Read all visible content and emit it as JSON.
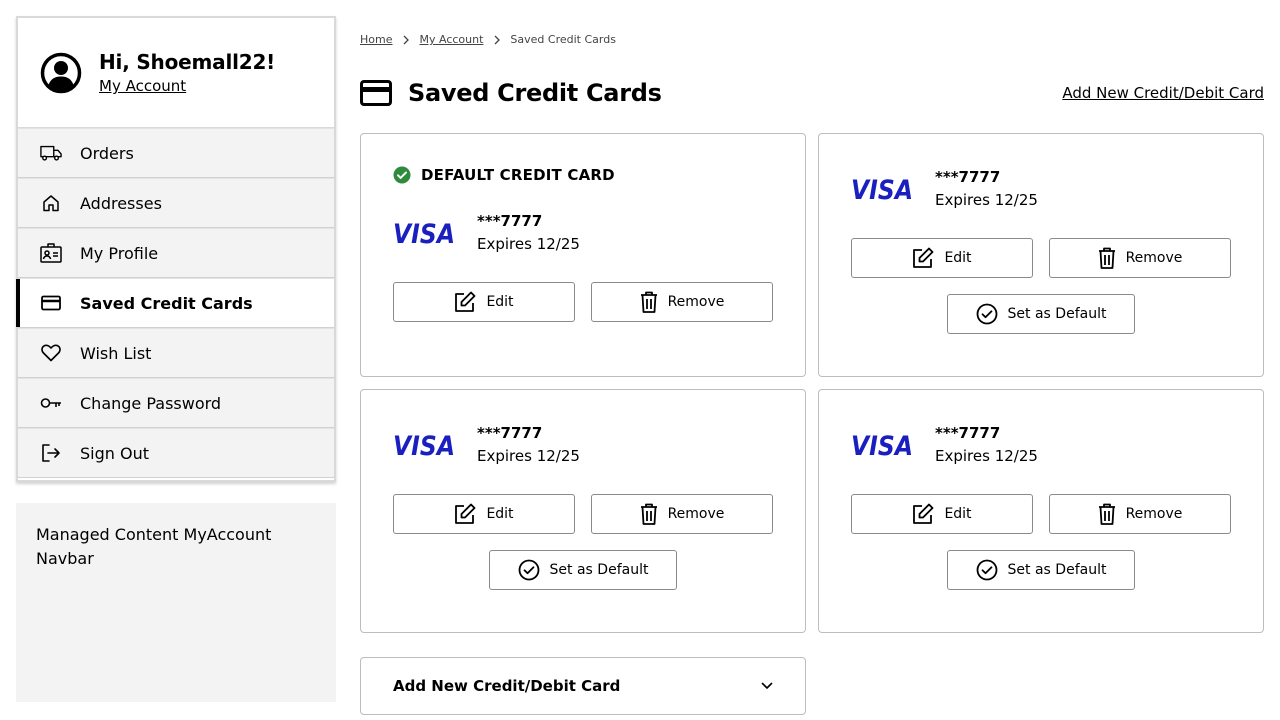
{
  "sidebar": {
    "greeting": "Hi, Shoemall22!",
    "account_link": "My Account",
    "items": [
      {
        "label": "Orders",
        "icon": "truck-icon",
        "active": false
      },
      {
        "label": "Addresses",
        "icon": "home-icon",
        "active": false
      },
      {
        "label": "My Profile",
        "icon": "profile-badge-icon",
        "active": false
      },
      {
        "label": "Saved Credit Cards",
        "icon": "credit-card-icon",
        "active": true
      },
      {
        "label": "Wish List",
        "icon": "heart-icon",
        "active": false
      },
      {
        "label": "Change Password",
        "icon": "key-icon",
        "active": false
      },
      {
        "label": "Sign Out",
        "icon": "sign-out-icon",
        "active": false
      }
    ],
    "managed_content": "Managed Content MyAccount Navbar"
  },
  "breadcrumb": [
    "Home",
    "My Account",
    "Saved Credit Cards"
  ],
  "page": {
    "title": "Saved Credit Cards",
    "add_link": "Add New Credit/Debit Card"
  },
  "cards": [
    {
      "default_label": "DEFAULT CREDIT CARD",
      "brand": "VISA",
      "number": "***7777",
      "expires": "Expires 12/25",
      "is_default": true
    },
    {
      "brand": "VISA",
      "number": "***7777",
      "expires": "Expires 12/25",
      "is_default": false
    },
    {
      "brand": "VISA",
      "number": "***7777",
      "expires": "Expires 12/25",
      "is_default": false
    },
    {
      "brand": "VISA",
      "number": "***7777",
      "expires": "Expires 12/25",
      "is_default": false
    }
  ],
  "buttons": {
    "edit": "Edit",
    "remove": "Remove",
    "set_default": "Set as Default"
  },
  "accordion": {
    "label": "Add New Credit/Debit Card"
  },
  "colors": {
    "visa_blue": "#1a1fbf",
    "default_check_green": "#2e8b3e",
    "sidebar_bg": "#f3f3f3",
    "border": "#bdbdbd"
  }
}
